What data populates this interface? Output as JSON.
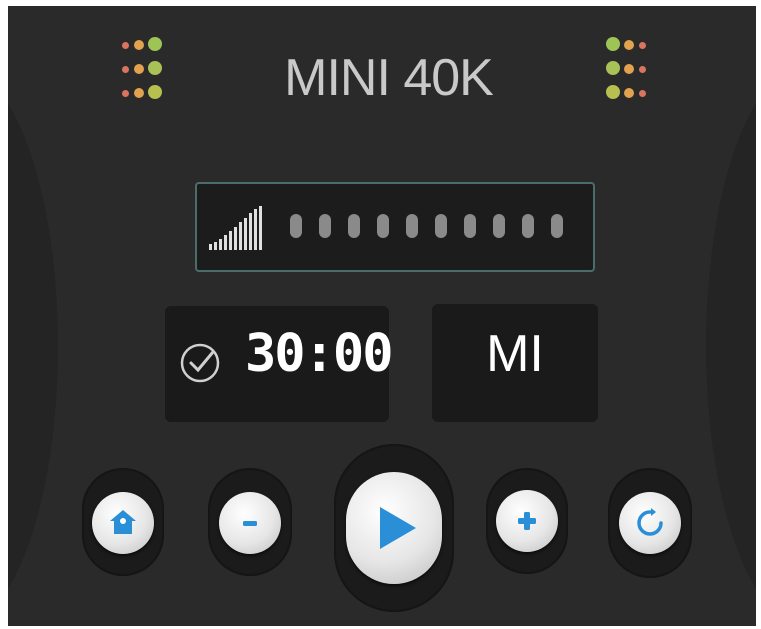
{
  "device": {
    "title": "MINI 40K"
  },
  "meter": {
    "level": 1,
    "dots": 10
  },
  "timer": {
    "value": "30:00",
    "icon": "check-circle-icon"
  },
  "unit": {
    "label": "MI"
  },
  "controls": [
    {
      "name": "home-button",
      "icon": "home-icon"
    },
    {
      "name": "decrease-button",
      "icon": "minus-icon"
    },
    {
      "name": "play-button",
      "icon": "play-icon"
    },
    {
      "name": "increase-button",
      "icon": "plus-icon"
    },
    {
      "name": "reset-button",
      "icon": "refresh-icon"
    }
  ],
  "colors": {
    "accent": "#2a8fd6",
    "panel": "#1a1a1a",
    "background": "#2a2a2a"
  }
}
